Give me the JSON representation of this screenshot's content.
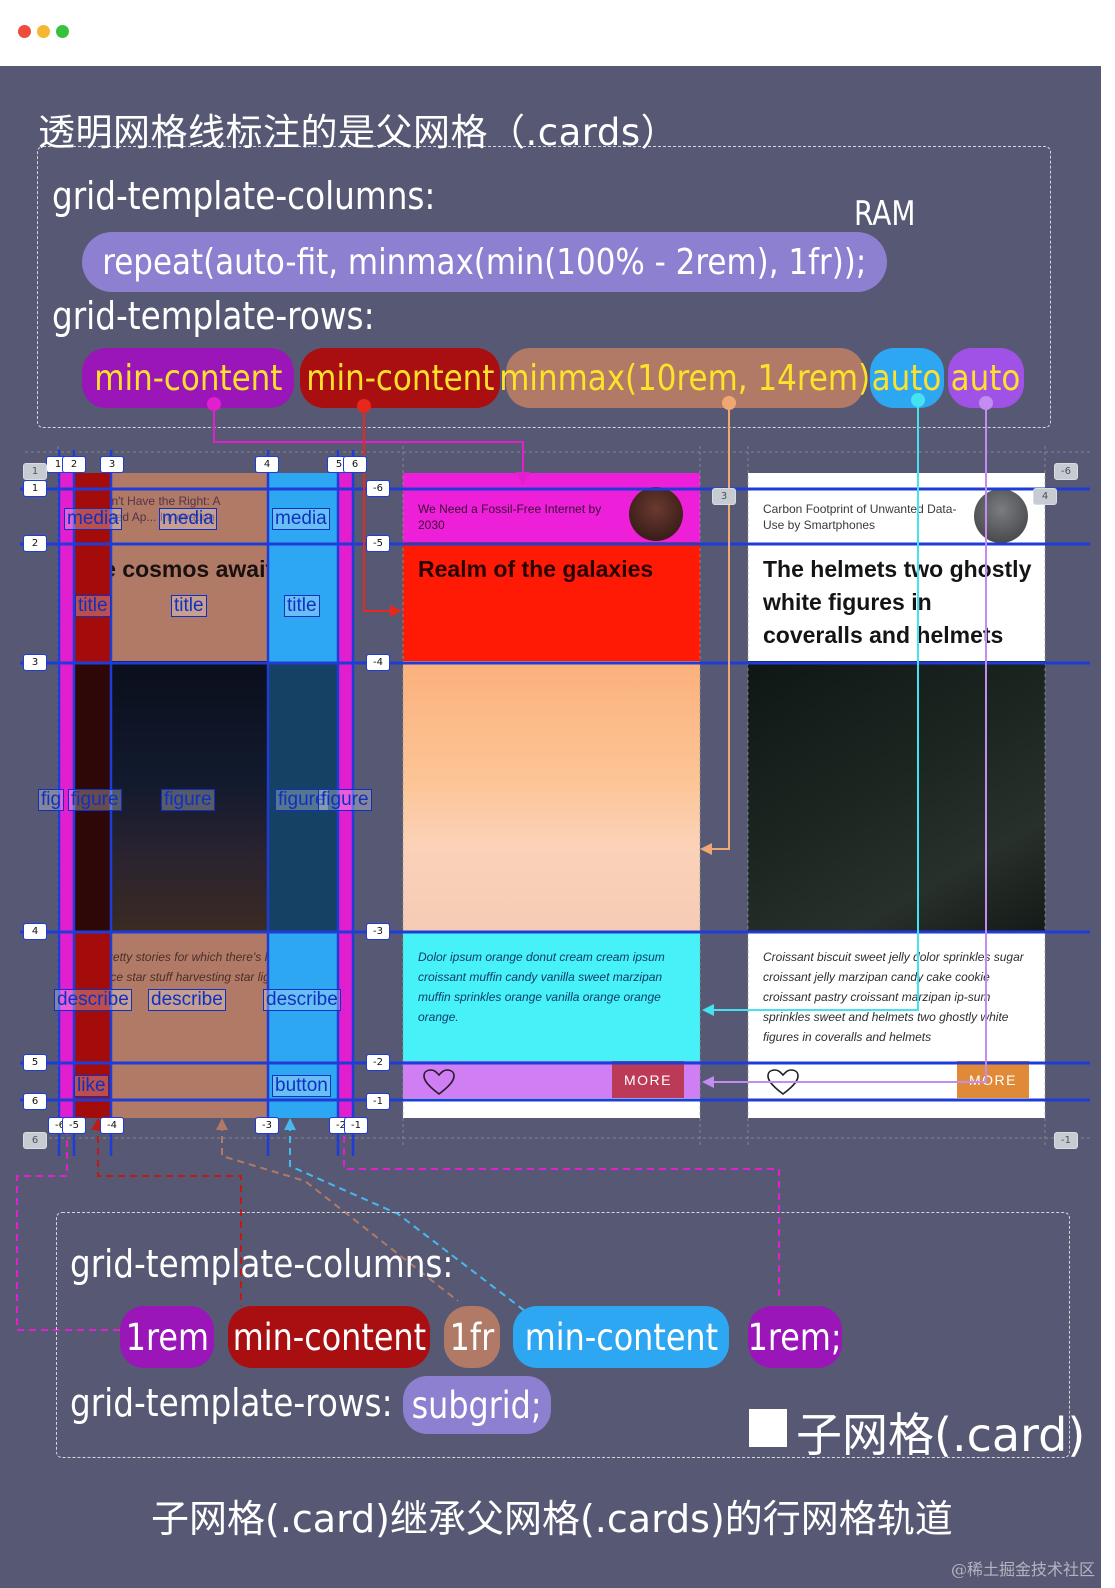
{
  "window": {
    "dots": [
      "close",
      "minimize",
      "zoom"
    ]
  },
  "colors": {
    "background": "#575874",
    "lavender": "#8d80d0",
    "purple": "#9a16b8",
    "darkred": "#a90f10",
    "tan": "#b07a66",
    "sky": "#2ea7f2",
    "violet": "#a052e6",
    "gridline": "#1f3dd6",
    "magenta": "#ee1fd8",
    "cyan": "#46f2f8",
    "red": "#ff1a05"
  },
  "top": {
    "heading": "透明网格线标注的是父网格（.cards）",
    "columns_label": "grid-template-columns:",
    "columns_value": "repeat(auto-fit, minmax(min(100%  - 2rem), 1fr));",
    "ram": "RAM",
    "rows_label": "grid-template-rows:",
    "rows_values": [
      "min-content",
      "min-content",
      "minmax(10rem, 14rem)",
      "auto",
      "auto"
    ]
  },
  "cards": [
    {
      "small": "We Don't Have the Right: A Neglected Ap... Innovation",
      "title": "The cosmos awaits"
    },
    {
      "small": "We Need a Fossil-Free Internet by 2030",
      "title": "Realm of the galaxies",
      "desc": "Dolor ipsum orange donut cream cream ipsum croissant muffin candy vanilla sweet marzipan muffin sprinkles orange vanilla orange orange orange.",
      "button": "MORE"
    },
    {
      "small": "Carbon Footprint of Unwanted Data-Use by Smartphones",
      "title": "The helmets two ghostly white figures in coveralls and helmets",
      "desc": "Croissant biscuit sweet jelly dolor sprinkles sugar croissant jelly marzipan candy cake cookie croissant pastry croissant marzipan ip-sum sprinkles sweet and helmets two ghostly white figures in coveralls and helmets",
      "button": "MORE"
    }
  ],
  "card1_desc": "With pretty stories for which there's little good evidence star stuff harvesting star light cir-",
  "areas": {
    "media": "media",
    "title": "title",
    "figure": "figure",
    "fig": "fig",
    "describe": "describe",
    "de": "de",
    "like": "like",
    "button": "button"
  },
  "lines": {
    "columns_positive": [
      "1",
      "2",
      "3",
      "4",
      "5",
      "6"
    ],
    "columns_negative": [
      "-6",
      "-5",
      "-4",
      "-3",
      "-2",
      "-1"
    ],
    "rows_positive": [
      "1",
      "2",
      "3",
      "4",
      "5",
      "6"
    ],
    "rows_negative": [
      "-6",
      "-5",
      "-4",
      "-3",
      "-2",
      "-1"
    ],
    "parent_columns_top": [
      "1",
      "3",
      "4"
    ],
    "parent_columns_bottom": [
      "-6",
      "-1"
    ]
  },
  "bottom": {
    "columns_label": "grid-template-columns:",
    "columns_values": [
      "1rem",
      "min-content",
      "1fr",
      "min-content",
      "1rem;"
    ],
    "rows_label": "grid-template-rows:",
    "rows_value": "subgrid;",
    "legend": "子网格(.card)",
    "caption": "子网格(.card)继承父网格(.cards)的行网格轨道",
    "watermark": "@稀土掘金技术社区"
  }
}
